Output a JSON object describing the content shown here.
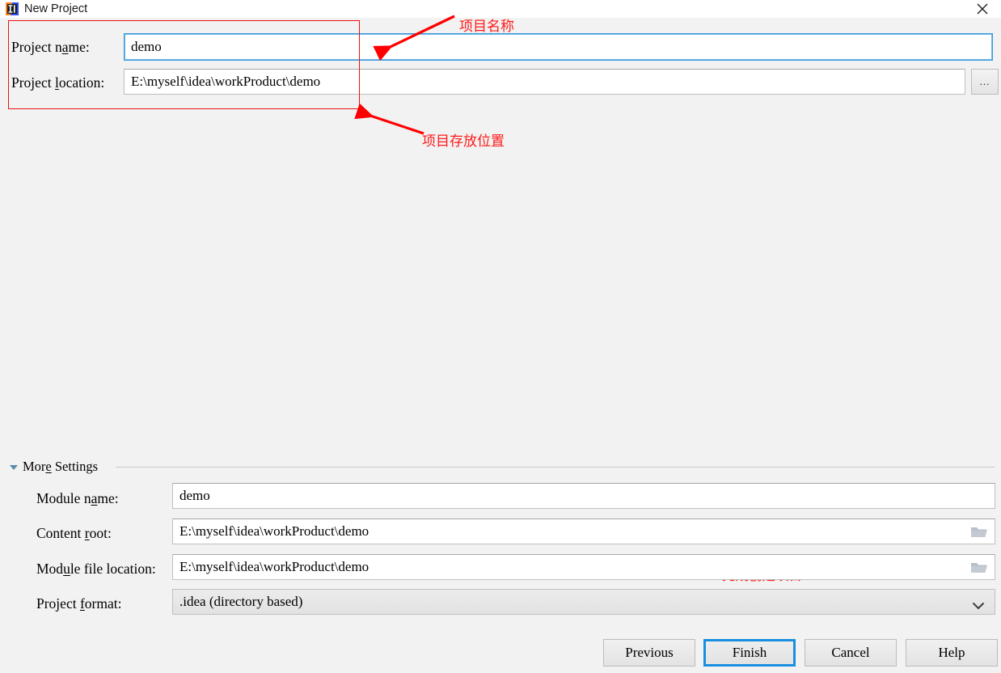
{
  "window": {
    "title": "New Project",
    "icon": "intellij-idea-logo",
    "close_icon": "close-icon"
  },
  "top_form": {
    "project_name": {
      "label_before": "Project n",
      "label_mnemonic": "a",
      "label_after": "me:",
      "value": "demo"
    },
    "project_location": {
      "label_before": "Project ",
      "label_mnemonic": "l",
      "label_after": "ocation:",
      "value": "E:\\myself\\idea\\workProduct\\demo"
    },
    "browse_button_label": "...",
    "browse_button_icon": "ellipsis-icon"
  },
  "annotations": {
    "accent_color": "#ff1a1a",
    "box_color": "#ee1111",
    "project_name_note": "项目名称",
    "project_location_note": "项目存放位置",
    "finish_note": "完成创建项目"
  },
  "more_settings": {
    "header_before": "Mor",
    "header_mnemonic": "e",
    "header_after": " Settings",
    "expanded": true,
    "toggle_icon": "triangle-down-icon",
    "rows": [
      {
        "label_before": "Module n",
        "label_mnemonic": "a",
        "label_after": "me:",
        "value": "demo",
        "trailing_icon": null,
        "type": "text"
      },
      {
        "label_before": "Content ",
        "label_mnemonic": "r",
        "label_after": "oot:",
        "value": "E:\\myself\\idea\\workProduct\\demo",
        "trailing_icon": "folder-icon",
        "type": "text"
      },
      {
        "label_before": "Mod",
        "label_mnemonic": "u",
        "label_after": "le file location:",
        "value": "E:\\myself\\idea\\workProduct\\demo",
        "trailing_icon": "folder-icon",
        "type": "text"
      },
      {
        "label_before": "Project ",
        "label_mnemonic": "f",
        "label_after": "ormat:",
        "value": ".idea (directory based)",
        "trailing_icon": "chevron-down-icon",
        "type": "combo"
      }
    ]
  },
  "buttons": {
    "previous": "Previous",
    "finish": "Finish",
    "cancel": "Cancel",
    "help": "Help",
    "default_button": "Finish",
    "focus_color": "#1a8fe0"
  }
}
